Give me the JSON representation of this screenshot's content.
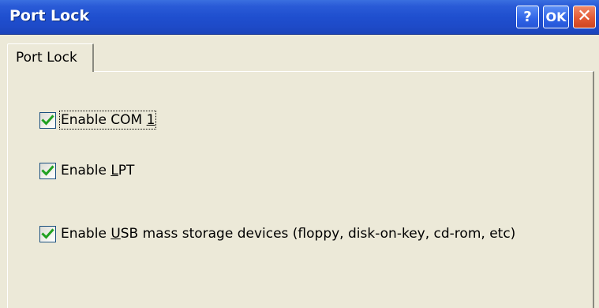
{
  "window": {
    "title": "Port Lock",
    "buttons": {
      "help_label": "?",
      "ok_label": "OK",
      "close_label": "✕"
    }
  },
  "tabs": [
    {
      "label": "Port Lock",
      "selected": true
    }
  ],
  "options": [
    {
      "label": "Enable COM 1",
      "mnemonic": "1",
      "checked": true,
      "focused": true
    },
    {
      "label": "Enable LPT",
      "mnemonic": "L",
      "checked": true,
      "focused": false
    },
    {
      "label": "Enable USB mass storage devices (floppy, disk-on-key, cd-rom, etc)",
      "mnemonic": "U",
      "checked": true,
      "focused": false
    }
  ],
  "colors": {
    "titlebar": "#1f4fcf",
    "check_mark": "#21a121",
    "background": "#ece9d8"
  }
}
